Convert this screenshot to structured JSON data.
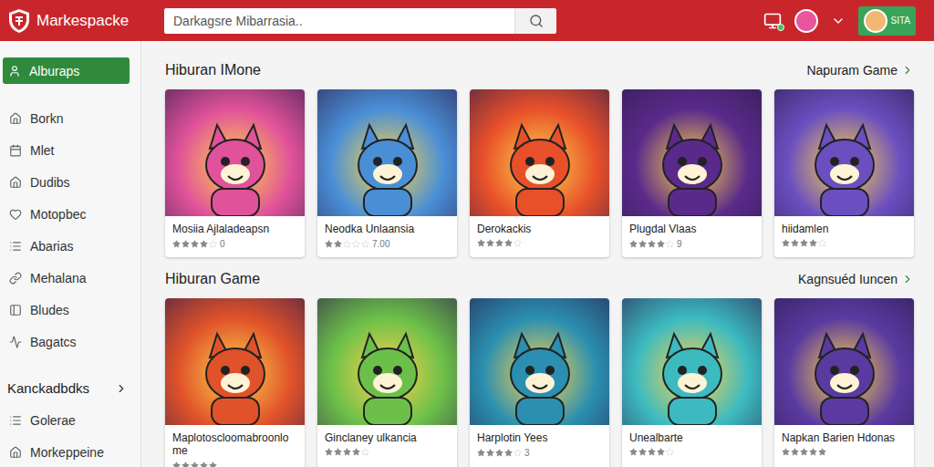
{
  "header": {
    "logo": "Markespacke",
    "search": {
      "placeholder": "Darkagsre Mibarrasia.."
    },
    "notification": true,
    "profile": {
      "label": "SITA"
    }
  },
  "sidebar": {
    "items": [
      {
        "label": "Alburaps",
        "selected": true
      },
      {
        "label": "Borkn",
        "selected": false
      },
      {
        "label": "Mlet",
        "selected": false
      },
      {
        "label": "Dudibs",
        "selected": false
      },
      {
        "label": "Motopbec",
        "selected": false
      },
      {
        "label": "Abarias",
        "selected": false
      },
      {
        "label": "Mehalana",
        "selected": false
      },
      {
        "label": "Bludes",
        "selected": false
      },
      {
        "label": "Bagatcs",
        "selected": false
      }
    ],
    "group": {
      "label": "Kanckadbdks",
      "expanded": false
    },
    "footer_items": [
      {
        "label": "Golerae",
        "selected": false
      },
      {
        "label": "Morkeppeine",
        "selected": false
      }
    ]
  },
  "sections": [
    {
      "title": "Hiburan IMone",
      "link": "Napuram Game",
      "cards": [
        {
          "title": "Mosiia Ajlaladeapsn",
          "stars": 4,
          "rating": "0",
          "color": "#e0529a"
        },
        {
          "title": "Neodka Unlaansia",
          "stars": 2,
          "rating": "7.00",
          "color": "#4a8fd6"
        },
        {
          "title": "Derokackis",
          "stars": 4,
          "rating": "",
          "color": "#e8502a"
        },
        {
          "title": "Plugdal Vlaas",
          "stars": 4,
          "rating": "9",
          "color": "#5a2a8a"
        },
        {
          "title": "hiidamlen",
          "stars": 4,
          "rating": "",
          "color": "#6b4fc0"
        }
      ]
    },
    {
      "title": "Hiburan Game",
      "link": "Kagnsuéd Iuncen",
      "cards": [
        {
          "title": "Maplotoscloomabroonlome",
          "stars": 5,
          "rating": "",
          "color": "#e0522a"
        },
        {
          "title": "Ginclaney ulkancia",
          "stars": 4,
          "rating": "",
          "color": "#6cc04a"
        },
        {
          "title": "Harplotin Yees",
          "stars": 4,
          "rating": "3",
          "color": "#2a8fb0"
        },
        {
          "title": "Unealbarte",
          "stars": 4,
          "rating": "",
          "color": "#3cbac0"
        },
        {
          "title": "Napkan Barien Hdonas",
          "stars": 5,
          "rating": "",
          "color": "#5a3aa0"
        }
      ]
    }
  ]
}
